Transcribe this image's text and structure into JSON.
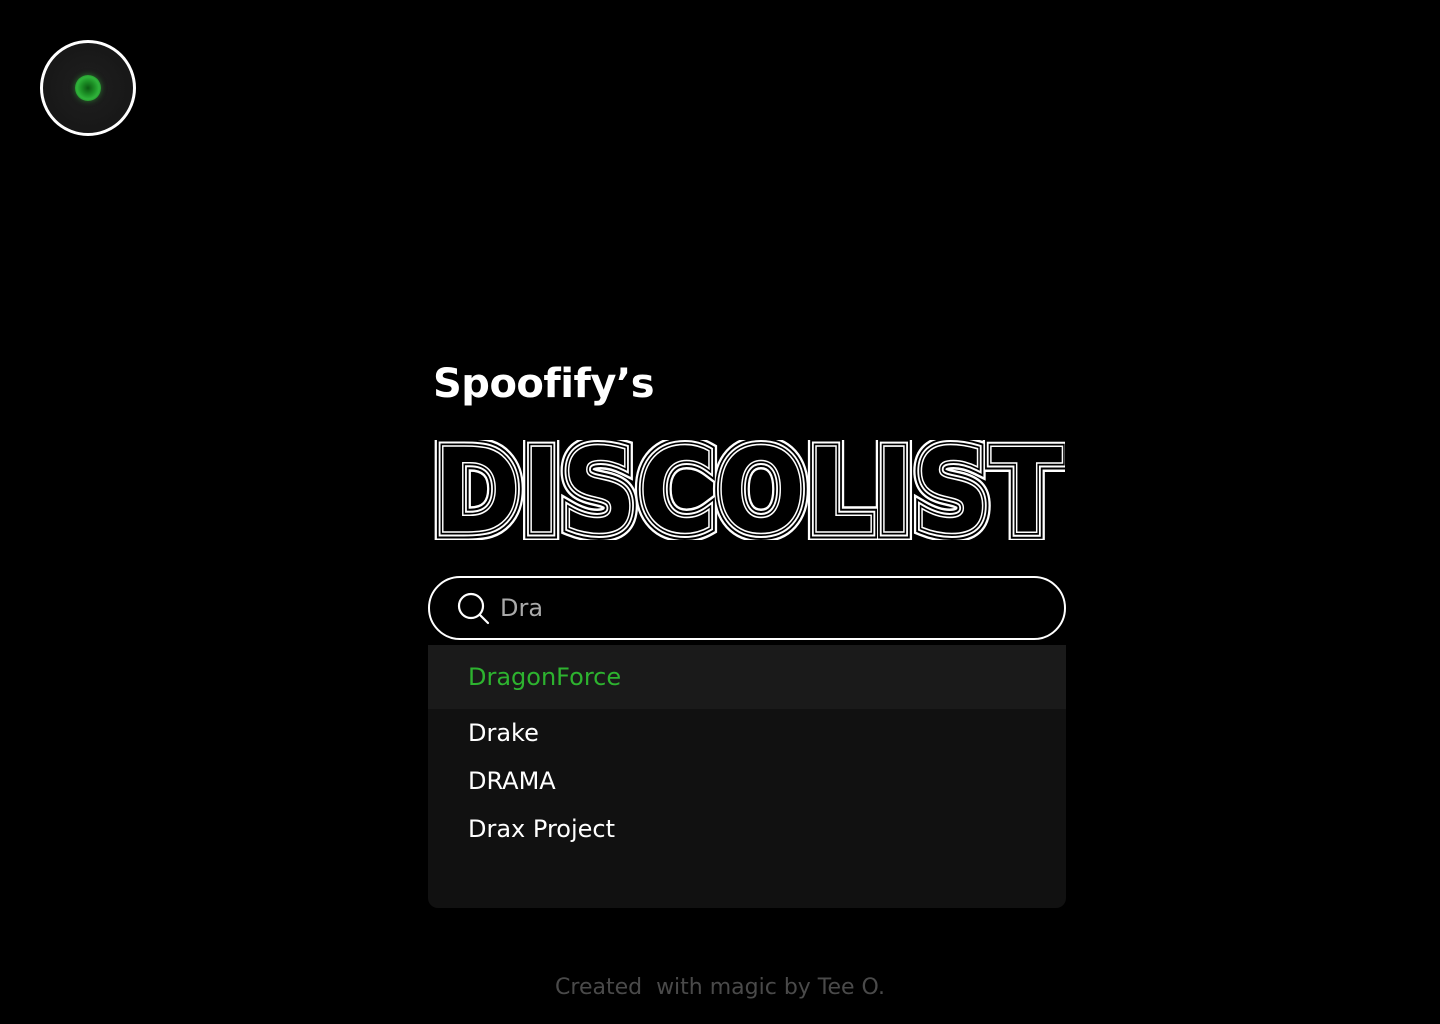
{
  "header": {
    "subtitle": "Spoofify’s",
    "title": "DISCOLIST"
  },
  "search": {
    "value": "Dra",
    "icon": "search-icon"
  },
  "results": [
    {
      "label": "DragonForce",
      "highlighted": true
    },
    {
      "label": "Drake",
      "highlighted": false
    },
    {
      "label": "DRAMA",
      "highlighted": false
    },
    {
      "label": "Drax Project",
      "highlighted": false
    }
  ],
  "footer": {
    "text": "Created  with magic by Tee O."
  },
  "colors": {
    "background": "#000000",
    "accent": "#2db32f",
    "dropdown": "#111111",
    "footer": "#4a4a4a"
  }
}
